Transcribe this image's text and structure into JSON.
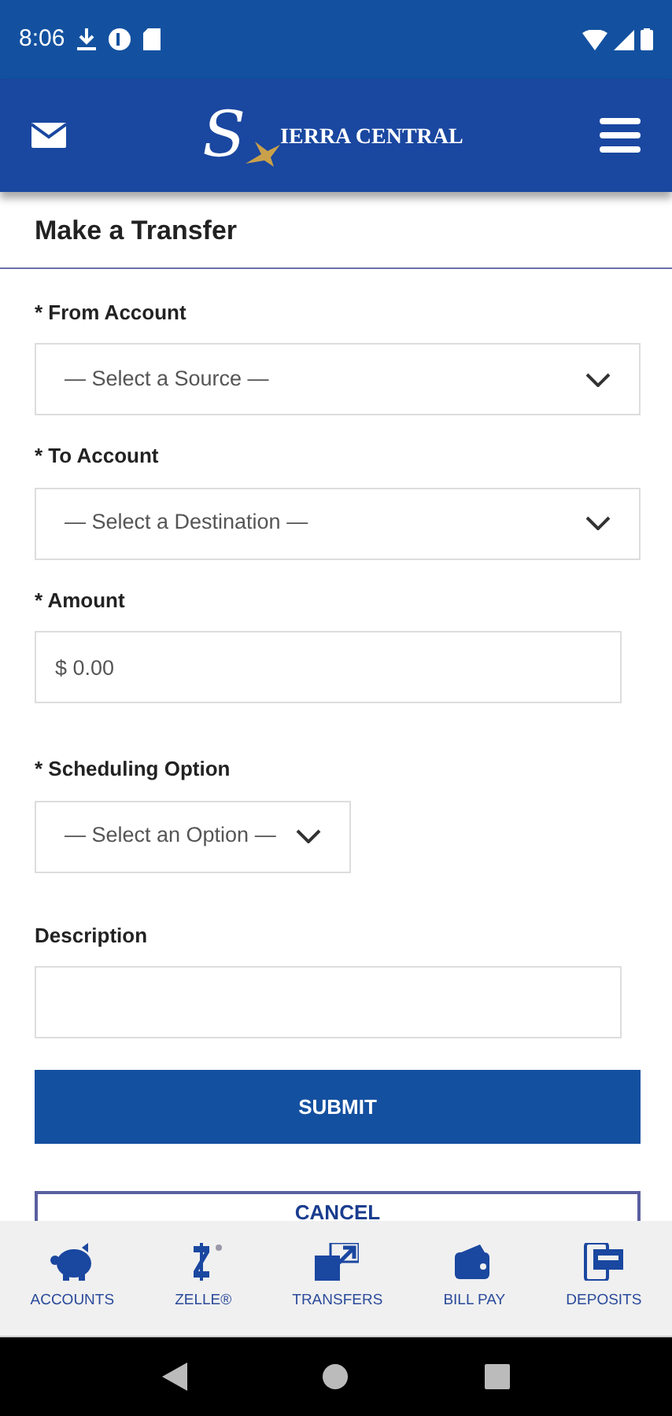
{
  "status_bar": {
    "time": "8:06"
  },
  "header": {
    "logo_initial": "S",
    "logo_text": "IERRA CENTRAL"
  },
  "page_title": "Make a Transfer",
  "fields": [
    {
      "kind": "select",
      "label": "* From Account",
      "placeholder": "— Select a Source —"
    },
    {
      "kind": "select",
      "label": "* To Account",
      "placeholder": "— Select a Destination —"
    },
    {
      "kind": "input",
      "label": "* Amount",
      "value": "$ 0.00"
    },
    {
      "kind": "select",
      "label": "* Scheduling Option",
      "placeholder": "— Select an Option —"
    },
    {
      "kind": "input",
      "label": "Description"
    }
  ],
  "buttons": [
    {
      "kind": "primary",
      "label": "SUBMIT"
    },
    {
      "kind": "outline",
      "label": "CANCEL"
    }
  ],
  "bottom_nav": [
    {
      "label": "ACCOUNTS"
    },
    {
      "label": "ZELLE®"
    },
    {
      "label": "TRANSFERS"
    },
    {
      "label": "BILL PAY"
    },
    {
      "label": "DEPOSITS"
    }
  ]
}
